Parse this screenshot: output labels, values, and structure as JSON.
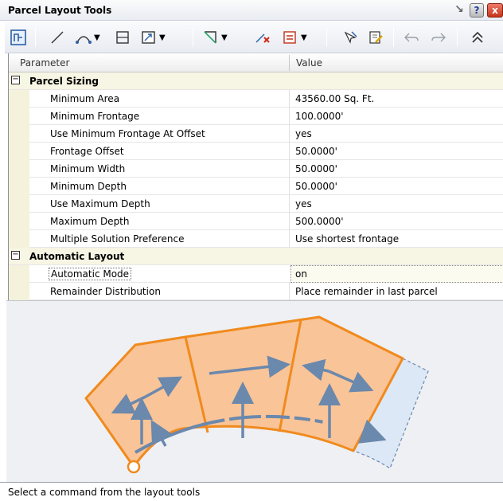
{
  "window": {
    "title": "Parcel Layout Tools",
    "help_label": "?",
    "close_label": "x"
  },
  "toolbar": {
    "tools": [
      "parcel-layout-icon",
      "line-icon",
      "curve-icon",
      "rectangle-icon",
      "parcel-sizing-icon",
      "draw-tangent-icon",
      "delete-sub-entity-icon",
      "parcel-union-icon",
      "pick-sub-entity-icon",
      "sub-entity-editor-icon",
      "undo-icon",
      "redo-icon",
      "collapse-icon"
    ]
  },
  "grid": {
    "columns": [
      "Parameter",
      "Value"
    ],
    "categories": [
      {
        "label": "Parcel Sizing",
        "rows": [
          {
            "name": "Minimum Area",
            "value": "43560.00 Sq. Ft."
          },
          {
            "name": "Minimum Frontage",
            "value": "100.0000'"
          },
          {
            "name": "Use Minimum Frontage At Offset",
            "value": "yes"
          },
          {
            "name": "Frontage Offset",
            "value": "50.0000'"
          },
          {
            "name": "Minimum Width",
            "value": "50.0000'"
          },
          {
            "name": "Minimum Depth",
            "value": "50.0000'"
          },
          {
            "name": "Use Maximum Depth",
            "value": "yes"
          },
          {
            "name": "Maximum Depth",
            "value": "500.0000'"
          },
          {
            "name": "Multiple Solution Preference",
            "value": "Use shortest frontage"
          }
        ]
      },
      {
        "label": "Automatic Layout",
        "rows": [
          {
            "name": "Automatic Mode",
            "value": "on"
          },
          {
            "name": "Remainder Distribution",
            "value": "Place remainder in last parcel"
          }
        ]
      }
    ]
  },
  "colors": {
    "parcel_fill": "#f9c497",
    "parcel_stroke": "#f08a1e",
    "arrow": "#6b88ad",
    "remainder_fill": "#dce8f6"
  },
  "status": {
    "text": "Select a command from the layout tools"
  }
}
